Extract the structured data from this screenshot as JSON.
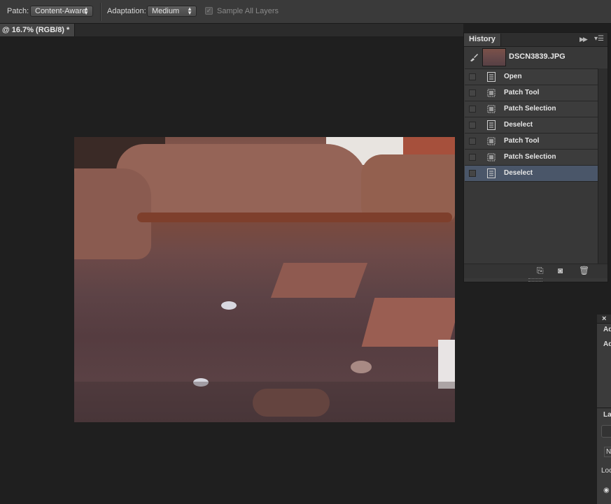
{
  "options_bar": {
    "patch_label": "Patch:",
    "patch_value": "Content-Aware",
    "adaptation_label": "Adaptation:",
    "adaptation_value": "Medium",
    "sample_all_layers_label": "Sample All Layers",
    "sample_all_layers_checked": true
  },
  "document": {
    "tab_title": "@ 16.7% (RGB/8) *"
  },
  "history_panel": {
    "title": "History",
    "snapshot_name": "DSCN3839.JPG",
    "items": [
      {
        "label": "Open",
        "icon": "document-icon",
        "selected": false
      },
      {
        "label": "Patch Tool",
        "icon": "patch-tool-icon",
        "selected": false
      },
      {
        "label": "Patch Selection",
        "icon": "patch-tool-icon",
        "selected": false
      },
      {
        "label": "Deselect",
        "icon": "document-icon",
        "selected": false
      },
      {
        "label": "Patch Tool",
        "icon": "patch-tool-icon",
        "selected": false
      },
      {
        "label": "Patch Selection",
        "icon": "patch-tool-icon",
        "selected": false
      },
      {
        "label": "Deselect",
        "icon": "document-icon",
        "selected": true
      }
    ]
  },
  "right_dock": {
    "close_glyph": "×",
    "adjust_tab_1": "Ad",
    "adjust_tab_2": "Ad",
    "layers_tab": "La",
    "kind_button": "N",
    "lock_label": "Loc"
  },
  "colors": {
    "selected_row": "#4a5669",
    "panel_bg": "#383838",
    "toolbar_bg": "#3a3a3a"
  }
}
